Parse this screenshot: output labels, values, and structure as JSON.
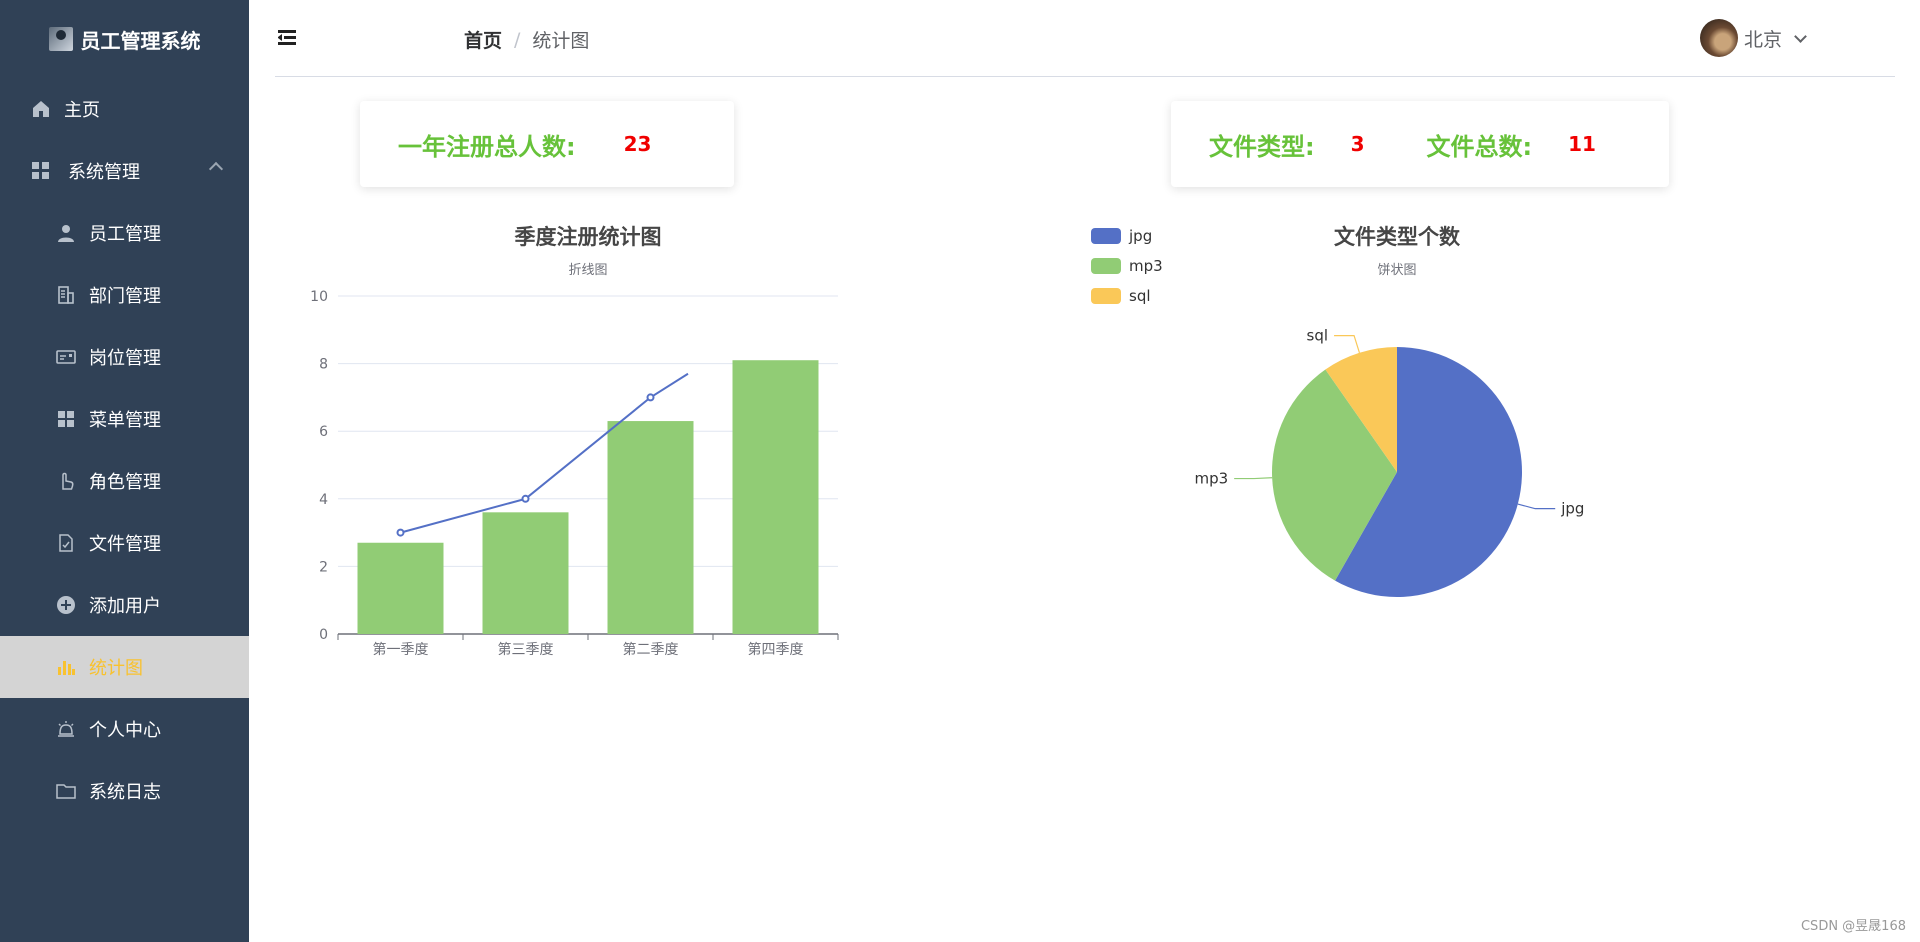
{
  "app": {
    "title": "员工管理系统"
  },
  "sidebar": {
    "items": [
      {
        "label": "主页",
        "icon": "home-icon"
      },
      {
        "label": "系统管理",
        "icon": "grid-icon"
      },
      {
        "label": "员工管理",
        "icon": "user-icon"
      },
      {
        "label": "部门管理",
        "icon": "building-icon"
      },
      {
        "label": "岗位管理",
        "icon": "id-card-icon"
      },
      {
        "label": "菜单管理",
        "icon": "grid-icon"
      },
      {
        "label": "角色管理",
        "icon": "hand-icon"
      },
      {
        "label": "文件管理",
        "icon": "document-icon"
      },
      {
        "label": "添加用户",
        "icon": "plus-circle-icon"
      },
      {
        "label": "统计图",
        "icon": "bar-chart-icon"
      },
      {
        "label": "个人中心",
        "icon": "bell-icon"
      },
      {
        "label": "系统日志",
        "icon": "folder-icon"
      }
    ],
    "active_color": "#f8c230"
  },
  "header": {
    "breadcrumb_home": "首页",
    "breadcrumb_sep": "/",
    "breadcrumb_current": "统计图",
    "user_name": "北京"
  },
  "stats": {
    "annual_label": "一年注册总人数:",
    "annual_value": "23",
    "filetype_label": "文件类型:",
    "filetype_value": "3",
    "filetotal_label": "文件总数:",
    "filetotal_value": "11"
  },
  "chart_data": [
    {
      "type": "bar",
      "title": "季度注册统计图",
      "subtitle": "折线图",
      "categories": [
        "第一季度",
        "第三季度",
        "第二季度",
        "第四季度"
      ],
      "series": [
        {
          "type": "bar",
          "values": [
            2.7,
            3.6,
            6.3,
            8.1
          ],
          "color": "#91cc75"
        },
        {
          "type": "line",
          "values": [
            3,
            4,
            7,
            7.7
          ],
          "color": "#5470c6"
        }
      ],
      "ylim": [
        0,
        10
      ],
      "yticks": [
        "0",
        "2",
        "4",
        "6",
        "8",
        "10"
      ],
      "grid": true
    },
    {
      "type": "pie",
      "title": "文件类型个数",
      "subtitle": "饼状图",
      "labels": [
        "jpg",
        "mp3",
        "sql"
      ],
      "values": [
        6,
        3.3,
        1
      ],
      "colors": [
        "#5470c6",
        "#91cc75",
        "#fac858"
      ],
      "legend": "top-left"
    }
  ],
  "watermark": "CSDN @昱晟168"
}
